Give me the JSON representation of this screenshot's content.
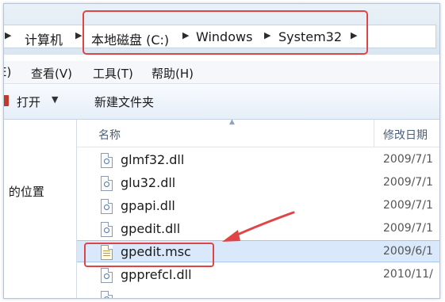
{
  "breadcrumb": {
    "items": [
      "计算机",
      "本地磁盘 (C:)",
      "Windows",
      "System32"
    ]
  },
  "menubar": {
    "items": [
      "查看(V)",
      "工具(T)",
      "帮助(H)"
    ]
  },
  "toolbar": {
    "open_label": "打开",
    "new_folder_label": "新建文件夹"
  },
  "nav": {
    "partial_label": "的位置"
  },
  "columns": {
    "name": "名称",
    "date": "修改日期"
  },
  "files": [
    {
      "name": "glmf32.dll",
      "date": "2009/7/1",
      "type": "dll"
    },
    {
      "name": "glu32.dll",
      "date": "2009/7/1",
      "type": "dll"
    },
    {
      "name": "gpapi.dll",
      "date": "2009/7/1",
      "type": "dll"
    },
    {
      "name": "gpedit.dll",
      "date": "2009/7/1",
      "type": "dll"
    },
    {
      "name": "gpedit.msc",
      "date": "2009/6/1",
      "type": "msc",
      "selected": true
    },
    {
      "name": "gpprefcl.dll",
      "date": "2010/11/",
      "type": "dll"
    }
  ],
  "colors": {
    "highlight": "#e04545",
    "selection": "#d9e8fb"
  }
}
